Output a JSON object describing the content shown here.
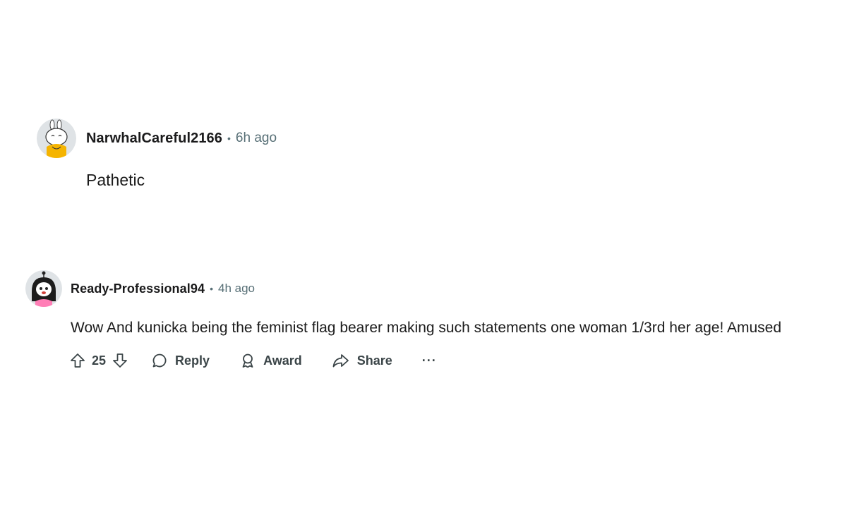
{
  "comments": [
    {
      "username": "NarwhalCareful2166",
      "separator": "•",
      "time": "6h ago",
      "body": "Pathetic"
    },
    {
      "username": "Ready-Professional94",
      "separator": "•",
      "time": "4h ago",
      "body": "Wow And kunicka being the feminist flag bearer making such statements one woman 1/3rd her age! Amused",
      "actions": {
        "vote_count": "25",
        "reply_label": "Reply",
        "award_label": "Award",
        "share_label": "Share",
        "more_label": "···"
      }
    }
  ],
  "icons": {
    "upvote": "arrow-up-outline-icon",
    "downvote": "arrow-down-outline-icon",
    "reply": "speech-bubble-icon",
    "award": "award-ribbon-icon",
    "share": "share-arrow-icon"
  }
}
